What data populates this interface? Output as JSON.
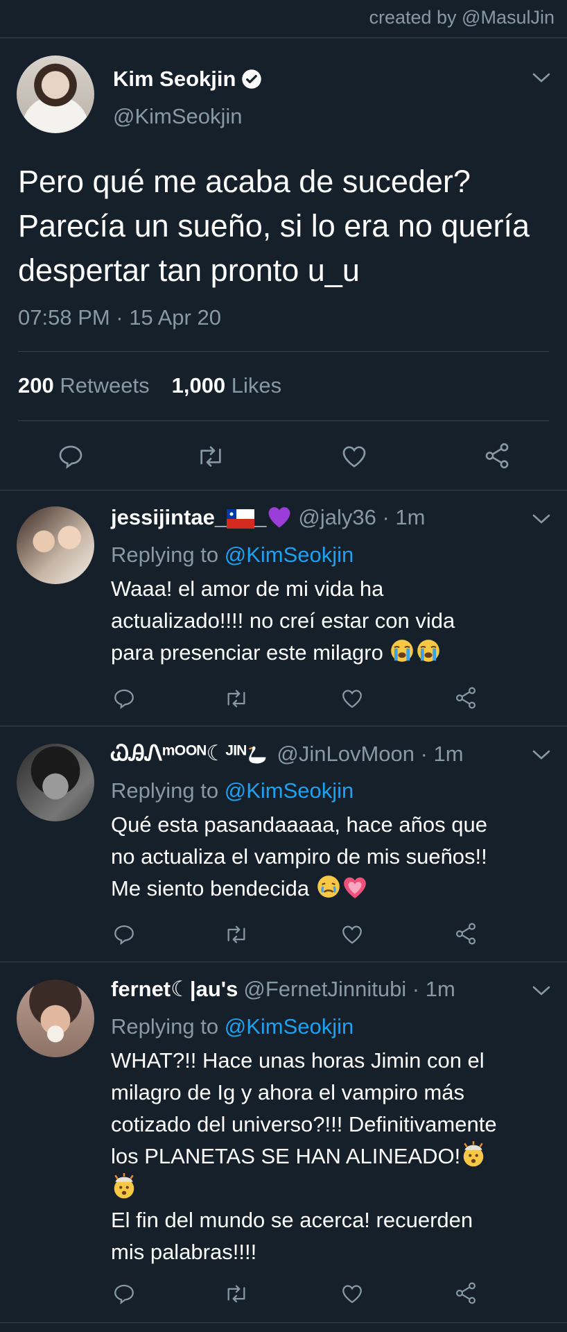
{
  "watermark": "created by @MasulJin",
  "main_tweet": {
    "name": "Kim Seokjin",
    "handle": "@KimSeokjin",
    "text": "Pero qué me acaba de suceder? Parecía un sueño, si lo era no quería despertar tan pronto u_u",
    "timestamp": "07:58 PM · 15 Apr 20",
    "retweets_count": "200",
    "retweets_label": "Retweets",
    "likes_count": "1,000",
    "likes_label": "Likes"
  },
  "replies": [
    {
      "name": "jessijintae_",
      "name_suffix": "_",
      "handle": "@jaly36 · 1m",
      "replying_prefix": "Replying to",
      "replying_to": "@KimSeokjin",
      "text_lines": [
        "Waaa! el amor de mi vida ha",
        "actualizado!!!! no creí estar con vida",
        "para presenciar este milagro"
      ],
      "emojis": [
        "loudly-crying-face",
        "loudly-crying-face"
      ]
    },
    {
      "name": "ᏇᎯᏁᵐᴼᴼᴺ☾ᴶᴵᴺ",
      "handle": "@JinLovMoon · 1m",
      "replying_prefix": "Replying to",
      "replying_to": "@KimSeokjin",
      "text_lines": [
        "Qué esta pasandaaaaa, hace años que",
        "no actualiza el vampiro de mis sueños!!",
        "Me siento bendecida"
      ],
      "emojis": [
        "crying-face",
        "sparkling-heart"
      ]
    },
    {
      "name": "fernet☾|au's",
      "handle": "@FernetJinnitubi · 1m",
      "replying_prefix": "Replying to",
      "replying_to": "@KimSeokjin",
      "text_lines": [
        "WHAT?!! Hace unas horas Jimin con el",
        "milagro de Ig y ahora el vampiro más",
        "cotizado del universo?!!! Definitivamente",
        "los PLANETAS SE HAN ALINEADO!",
        "",
        "El fin del mundo se acerca! recuerden",
        "mis palabras!!!!"
      ],
      "emojis": [
        "exploding-head",
        "exploding-head"
      ]
    }
  ],
  "colors": {
    "background": "#15202b",
    "secondary_text": "#8899a6",
    "link": "#1da1f2",
    "divider": "#38444d"
  }
}
